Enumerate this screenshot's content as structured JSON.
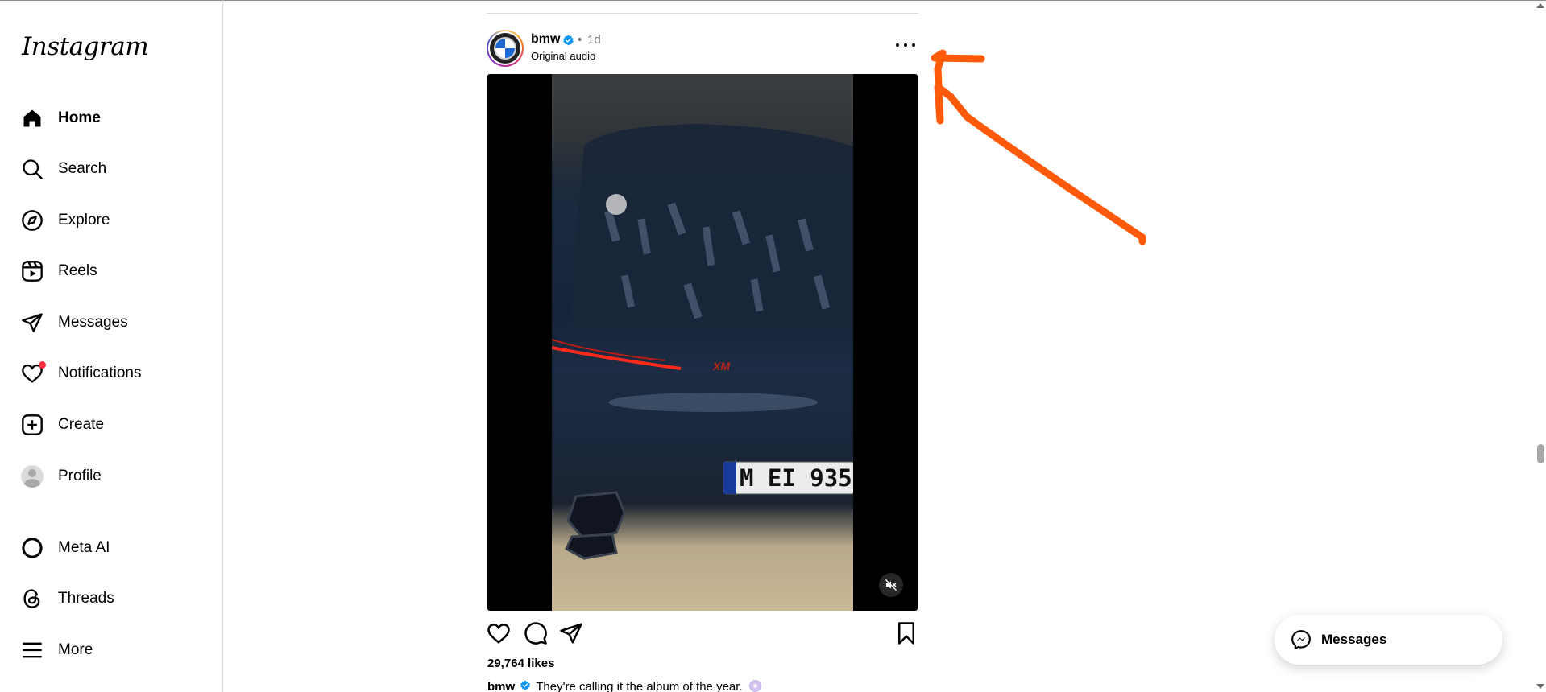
{
  "app": {
    "logo_text": "Instagram"
  },
  "sidebar": {
    "items": [
      {
        "label": "Home",
        "icon": "home-icon",
        "active": true
      },
      {
        "label": "Search",
        "icon": "search-icon"
      },
      {
        "label": "Explore",
        "icon": "compass-icon"
      },
      {
        "label": "Reels",
        "icon": "reels-icon"
      },
      {
        "label": "Messages",
        "icon": "paper-plane-icon"
      },
      {
        "label": "Notifications",
        "icon": "heart-icon",
        "has_dot": true
      },
      {
        "label": "Create",
        "icon": "plus-square-icon"
      },
      {
        "label": "Profile",
        "icon": "avatar-icon"
      },
      {
        "label": "Meta AI",
        "icon": "meta-ai-ring-icon"
      },
      {
        "label": "Threads",
        "icon": "threads-icon"
      },
      {
        "label": "More",
        "icon": "hamburger-icon"
      }
    ]
  },
  "post": {
    "username": "bmw",
    "verified": true,
    "separator": "•",
    "time": "1d",
    "audio": "Original audio",
    "likes": "29,764 likes",
    "caption_user": "bmw",
    "caption_text": "They're calling it the album of the year.",
    "license_plate": "M EI 935"
  },
  "floating": {
    "messages_label": "Messages"
  },
  "annotation": {
    "arrow_color": "#ff5a0a"
  },
  "colors": {
    "notification_dot": "#ff3040",
    "verified_blue": "#0095f6",
    "bmw_blue": "#1c69d4"
  }
}
